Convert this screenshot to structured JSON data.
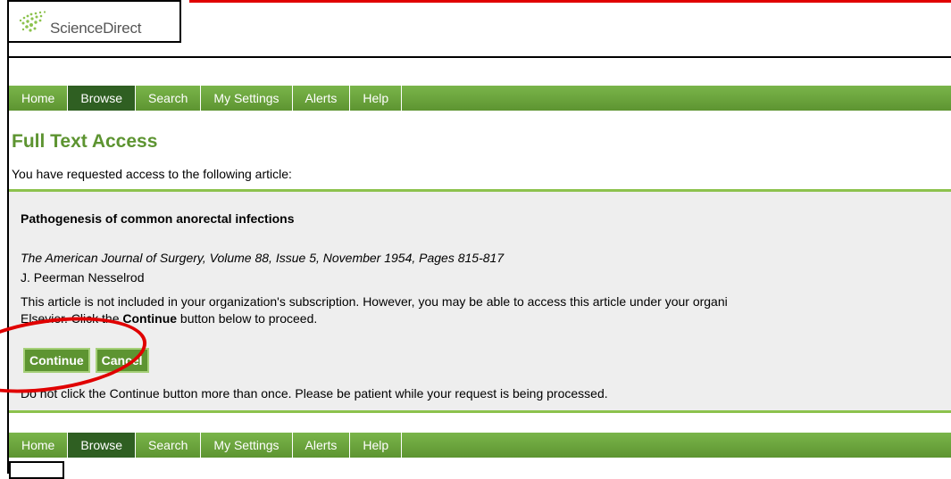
{
  "logo": {
    "text": "ScienceDirect"
  },
  "nav": {
    "items": [
      "Home",
      "Browse",
      "Search",
      "My Settings",
      "Alerts",
      "Help"
    ],
    "active": "Browse"
  },
  "page": {
    "title": "Full Text Access",
    "intro": "You have requested access to the following article:"
  },
  "article": {
    "title": "Pathogenesis of common anorectal infections",
    "citation": "The American Journal of Surgery, Volume 88, Issue 5, November 1954, Pages 815-817",
    "author": "J. Peerman Nesselrod",
    "notice_line1": "This article is not included in your organization's subscription. However, you may be able to access this article under your organi",
    "notice_line2_pre": "Elsevier. Click the ",
    "notice_line2_bold": "Continue",
    "notice_line2_post": " button below to proceed."
  },
  "buttons": {
    "continue_label": "Continue",
    "cancel_label": "Cancel"
  },
  "warning": "Do not click the Continue button more than once. Please be patient while your request is being processed.",
  "colors": {
    "nav_green": "#5d9431",
    "nav_active": "#2f5f22",
    "title_green": "#5d9431",
    "annotation_red": "#e00000"
  }
}
